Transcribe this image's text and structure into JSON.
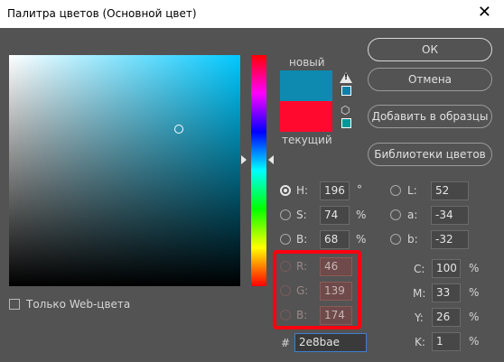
{
  "window": {
    "title": "Палитра цветов (Основной цвет)",
    "close_glyph": "✕"
  },
  "swatches": {
    "new_label": "новый",
    "current_label": "текущий",
    "new_color": "#0e8ab0",
    "current_color": "#ff0a2e",
    "warning_glyph": "!",
    "cube_glyph": "⬡"
  },
  "buttons": {
    "ok": "ОК",
    "cancel": "Отмена",
    "add_to_swatches": "Добавить в образцы",
    "color_libraries": "Библиотеки цветов"
  },
  "hsb": [
    {
      "label": "H:",
      "value": "196",
      "unit": "°",
      "selected": true
    },
    {
      "label": "S:",
      "value": "74",
      "unit": "%",
      "selected": false
    },
    {
      "label": "B:",
      "value": "68",
      "unit": "%",
      "selected": false
    }
  ],
  "rgb": [
    {
      "label": "R:",
      "value": "46"
    },
    {
      "label": "G:",
      "value": "139"
    },
    {
      "label": "B:",
      "value": "174"
    }
  ],
  "lab": [
    {
      "label": "L:",
      "value": "52"
    },
    {
      "label": "a:",
      "value": "-34"
    },
    {
      "label": "b:",
      "value": "-32"
    }
  ],
  "cmyk": [
    {
      "label": "C:",
      "value": "100",
      "unit": "%"
    },
    {
      "label": "M:",
      "value": "33",
      "unit": "%"
    },
    {
      "label": "Y:",
      "value": "26",
      "unit": "%"
    },
    {
      "label": "K:",
      "value": "1",
      "unit": "%"
    }
  ],
  "hex": {
    "label": "#",
    "value": "2e8bae"
  },
  "web_only": {
    "label": "Только Web-цвета",
    "checked": false
  },
  "colors": {
    "highlight": "#ff0010",
    "background": "#535353"
  }
}
